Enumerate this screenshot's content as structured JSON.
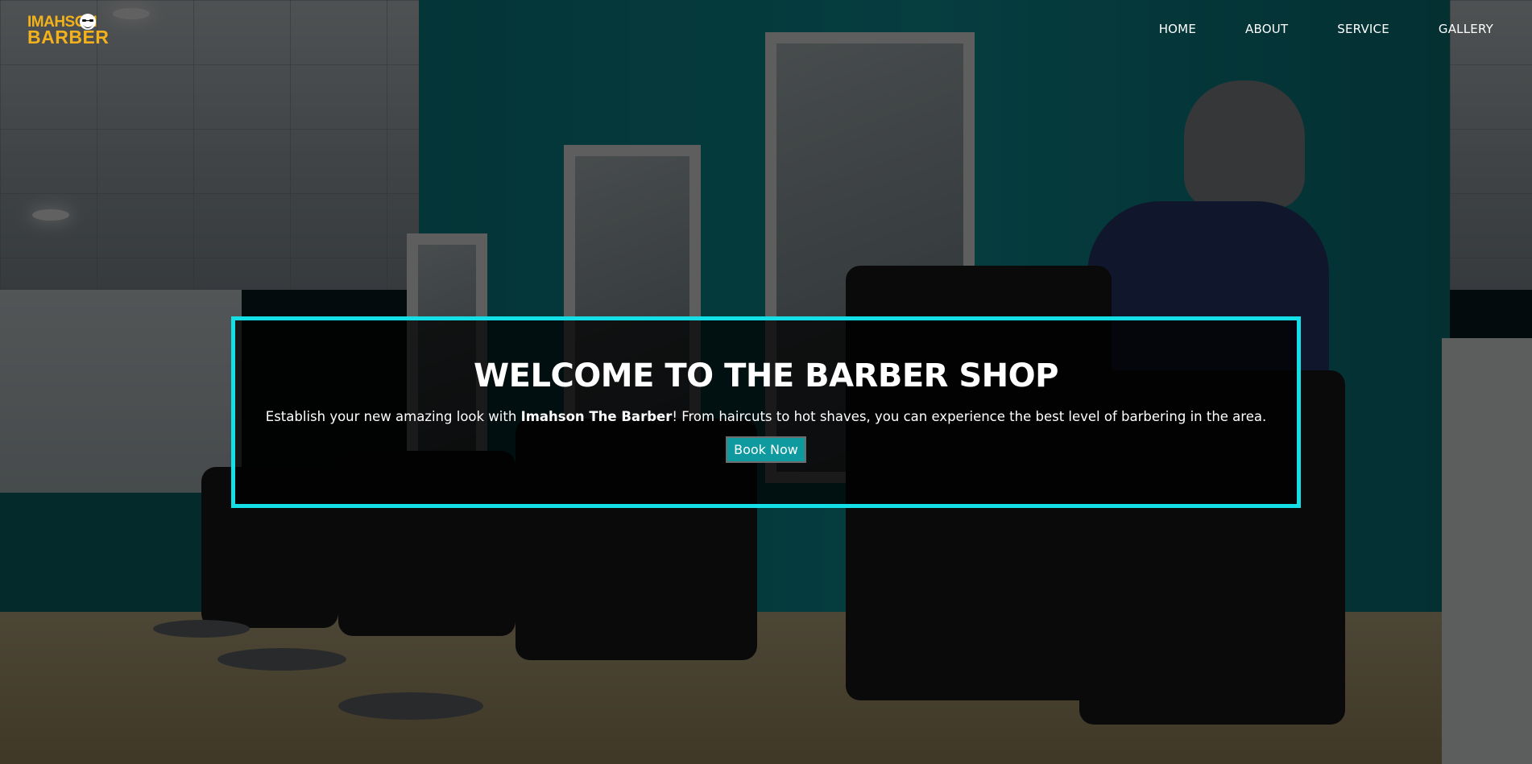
{
  "brand": {
    "logo_line1": "IMAHSON",
    "logo_line2": "BARBER",
    "logo_color": "#f3b21b"
  },
  "nav": {
    "items": [
      {
        "label": "HOME"
      },
      {
        "label": "ABOUT"
      },
      {
        "label": "SERVICE"
      },
      {
        "label": "GALLERY"
      }
    ]
  },
  "hero": {
    "title": "WELCOME TO THE BARBER SHOP",
    "text_before": "Establish your new amazing look with ",
    "text_bold": "Imahson The Barber",
    "text_after": "! From haircuts to hot shaves, you can experience the best level of barbering in the area.",
    "button_label": "Book Now",
    "border_color": "#14dfe6",
    "button_color": "#0f9aa0"
  },
  "icons": {
    "logo_mark": "bearded-face-icon"
  }
}
